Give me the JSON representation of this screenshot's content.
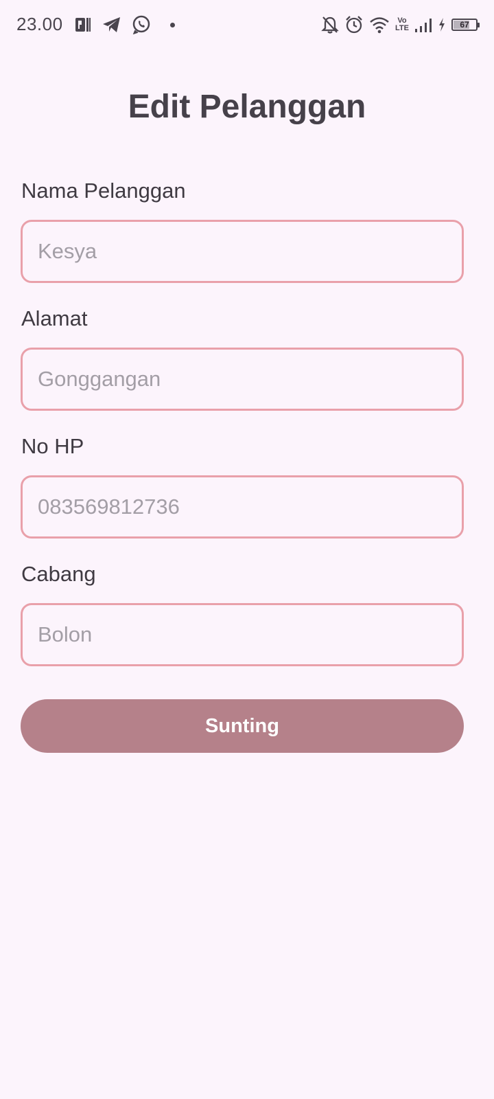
{
  "status_bar": {
    "time": "23.00",
    "battery_level": "67",
    "network_badge_top": "Vo",
    "network_badge_bottom": "LTE",
    "icons_left": [
      "parking-app-icon",
      "telegram-icon",
      "whatsapp-icon",
      "notification-dot"
    ],
    "icons_right": [
      "bell-off-icon",
      "alarm-icon",
      "wifi-icon",
      "volte-icon",
      "signal-icon",
      "charging-icon",
      "battery-icon"
    ]
  },
  "page": {
    "title": "Edit Pelanggan"
  },
  "form": {
    "fields": [
      {
        "label": "Nama Pelanggan",
        "placeholder": "Kesya",
        "value": ""
      },
      {
        "label": "Alamat",
        "placeholder": "Gonggangan",
        "value": ""
      },
      {
        "label": "No HP",
        "placeholder": "083569812736",
        "value": ""
      },
      {
        "label": "Cabang",
        "placeholder": "Bolon",
        "value": ""
      }
    ],
    "submit_label": "Sunting"
  },
  "colors": {
    "background": "#fcf4fc",
    "input_border": "#e9a0aa",
    "button": "#b5818a",
    "text": "#3f3a42",
    "placeholder": "#a39ea6"
  }
}
